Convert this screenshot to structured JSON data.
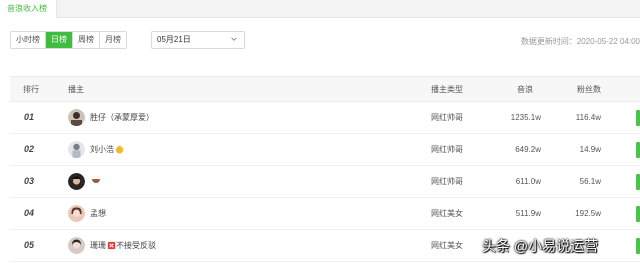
{
  "tabs": {
    "active": "音浪收入榜"
  },
  "period": {
    "options": [
      "小时榜",
      "日榜",
      "周榜",
      "月榜"
    ],
    "selected": "日榜"
  },
  "date": {
    "value": "05月21日"
  },
  "updated": {
    "text": "数据更新时间：2020-05-22 04:00"
  },
  "table": {
    "headers": {
      "rank": "排行",
      "host": "播主",
      "type": "播主类型",
      "sound": "音浪",
      "fans": "粉丝数"
    },
    "rows": [
      {
        "rank": "01",
        "name": "胜仔（承蒙厚爱）",
        "type": "网红帅哥",
        "sound": "1235.1w",
        "fans": "116.4w"
      },
      {
        "rank": "02",
        "name": "刘小浩",
        "type": "网红帅哥",
        "sound": "649.2w",
        "fans": "14.9w"
      },
      {
        "rank": "03",
        "name": "",
        "type": "网红帅哥",
        "sound": "611.0w",
        "fans": "56.1w"
      },
      {
        "rank": "04",
        "name": "孟想",
        "type": "网红美女",
        "sound": "511.9w",
        "fans": "192.5w"
      },
      {
        "rank": "05",
        "name": "珊珊",
        "name_suffix": "不接受反驳",
        "type": "网红美女",
        "sound": "",
        "fans": ""
      }
    ]
  },
  "watermark": {
    "text": "头条 @小易说运营"
  },
  "colors": {
    "accent": "#3fbd3f",
    "bar": "#4cc24c"
  }
}
